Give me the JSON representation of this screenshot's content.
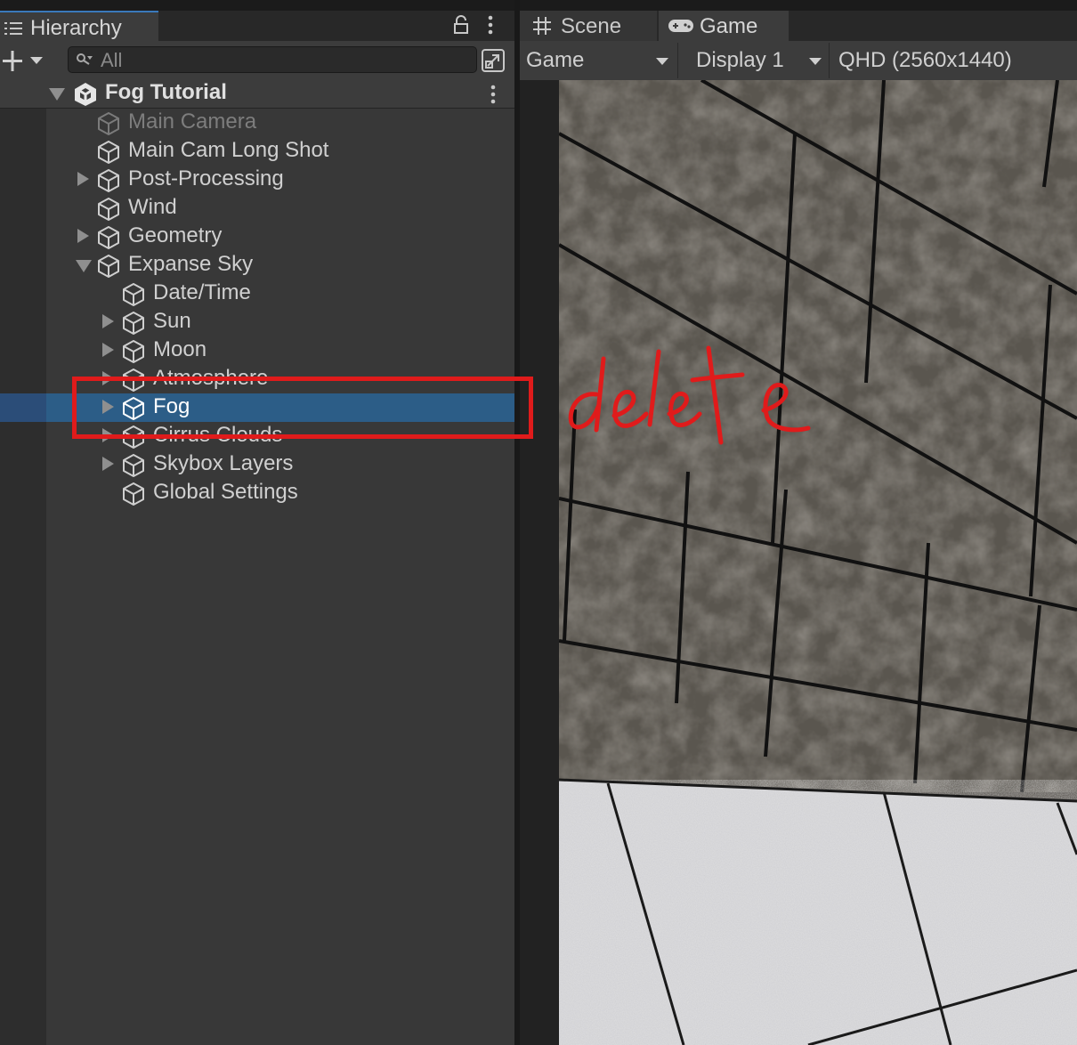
{
  "hierarchy": {
    "tab_label": "Hierarchy",
    "search_placeholder": "All",
    "scene_name": "Fog Tutorial",
    "items": [
      {
        "label": "Main Camera",
        "depth": 1,
        "expander": "none",
        "dimmed": true,
        "selected": false
      },
      {
        "label": "Main Cam Long Shot",
        "depth": 1,
        "expander": "none",
        "dimmed": false,
        "selected": false
      },
      {
        "label": "Post-Processing",
        "depth": 1,
        "expander": "collapsed",
        "dimmed": false,
        "selected": false
      },
      {
        "label": "Wind",
        "depth": 1,
        "expander": "none",
        "dimmed": false,
        "selected": false
      },
      {
        "label": "Geometry",
        "depth": 1,
        "expander": "collapsed",
        "dimmed": false,
        "selected": false
      },
      {
        "label": "Expanse Sky",
        "depth": 1,
        "expander": "expanded",
        "dimmed": false,
        "selected": false
      },
      {
        "label": "Date/Time",
        "depth": 2,
        "expander": "none",
        "dimmed": false,
        "selected": false
      },
      {
        "label": "Sun",
        "depth": 2,
        "expander": "collapsed",
        "dimmed": false,
        "selected": false
      },
      {
        "label": "Moon",
        "depth": 2,
        "expander": "collapsed",
        "dimmed": false,
        "selected": false
      },
      {
        "label": "Atmosphere",
        "depth": 2,
        "expander": "collapsed",
        "dimmed": false,
        "selected": false
      },
      {
        "label": "Fog",
        "depth": 2,
        "expander": "collapsed",
        "dimmed": false,
        "selected": true
      },
      {
        "label": "Cirrus Clouds",
        "depth": 2,
        "expander": "collapsed",
        "dimmed": false,
        "selected": false
      },
      {
        "label": "Skybox Layers",
        "depth": 2,
        "expander": "collapsed",
        "dimmed": false,
        "selected": false
      },
      {
        "label": "Global Settings",
        "depth": 2,
        "expander": "none",
        "dimmed": false,
        "selected": false
      }
    ]
  },
  "game_view": {
    "tabs": [
      {
        "label": "Scene",
        "icon": "grid-icon",
        "active": false
      },
      {
        "label": "Game",
        "icon": "gamepad-icon",
        "active": true
      }
    ],
    "toolbar": {
      "mode_dropdown": "Game",
      "display_dropdown": "Display 1",
      "resolution_dropdown": "QHD (2560x1440)"
    }
  },
  "annotation": {
    "handwritten_text": "delete",
    "color": "#e01b1b"
  },
  "colors": {
    "selection": "#2c5d87",
    "accent_tab": "#3a79bb",
    "annotation_red": "#e01b1b"
  }
}
